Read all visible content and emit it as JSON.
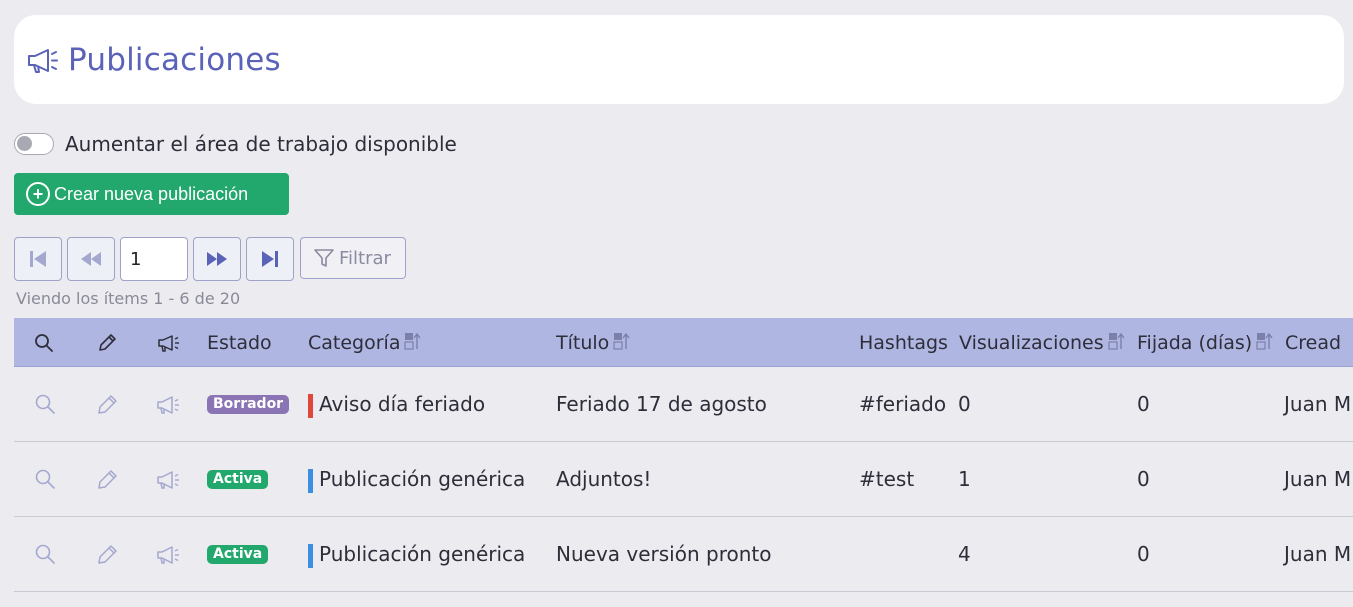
{
  "header": {
    "title": "Publicaciones",
    "icon": "megaphone-icon"
  },
  "toggle": {
    "label": "Aumentar el área de trabajo disponible",
    "on": false
  },
  "create_button": {
    "label": "Crear nueva publicación",
    "icon": "plus-circle-icon"
  },
  "pager": {
    "page": "1",
    "filter_label": "Filtrar",
    "range_text": "Viendo los ítems 1 - 6  de  20"
  },
  "table": {
    "columns": {
      "view": "search-icon",
      "edit": "pencil-icon",
      "publish": "megaphone-icon",
      "estado": "Estado",
      "categoria": "Categoría",
      "titulo": "Título",
      "hashtags": "Hashtags",
      "visualizaciones": "Visualizaciones",
      "fijada": "Fijada (días)",
      "creado": "Cread"
    },
    "rows": [
      {
        "estado": "Borrador",
        "estado_color": "#8a74b3",
        "categoria": "Aviso día feriado",
        "cat_color": "#e0463c",
        "titulo": "Feriado 17 de agosto",
        "hashtags": "#feriado",
        "visualizaciones": "0",
        "fijada": "0",
        "creado": "Juan M"
      },
      {
        "estado": "Activa",
        "estado_color": "#22a86d",
        "categoria": "Publicación genérica",
        "cat_color": "#3b8fe0",
        "titulo": "Adjuntos!",
        "hashtags": "#test",
        "visualizaciones": "1",
        "fijada": "0",
        "creado": "Juan M"
      },
      {
        "estado": "Activa",
        "estado_color": "#22a86d",
        "categoria": "Publicación genérica",
        "cat_color": "#3b8fe0",
        "titulo": "Nueva versión pronto",
        "hashtags": "",
        "visualizaciones": "4",
        "fijada": "0",
        "creado": "Juan M"
      }
    ]
  },
  "colors": {
    "accent": "#5a63b8",
    "header_bg": "#b0b6e2",
    "create_green": "#22a86d"
  }
}
